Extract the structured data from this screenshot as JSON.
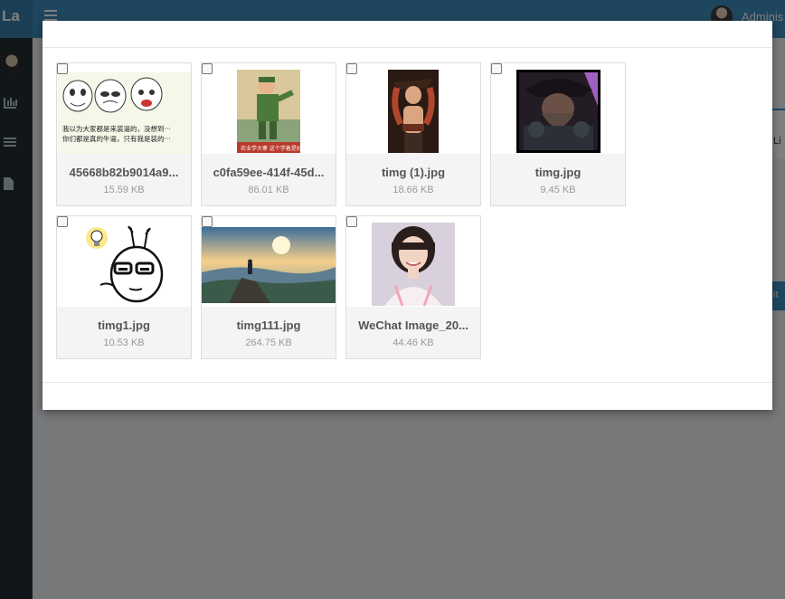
{
  "app": {
    "brand": "La",
    "user_name": "Adminis"
  },
  "background": {
    "panel_text": "Li",
    "button_label": "it"
  },
  "files": [
    {
      "name": "45668b82b9014a9...",
      "size": "15.59 KB",
      "thumb": "meme-faces"
    },
    {
      "name": "c0fa59ee-414f-45d...",
      "size": "86.01 KB",
      "thumb": "poster"
    },
    {
      "name": "timg (1).jpg",
      "size": "18.66 KB",
      "thumb": "pirate-woman"
    },
    {
      "name": "timg.jpg",
      "size": "9.45 KB",
      "thumb": "pirate-man"
    },
    {
      "name": "timg1.jpg",
      "size": "10.53 KB",
      "thumb": "bunny-lightbulb"
    },
    {
      "name": "timg111.jpg",
      "size": "264.75 KB",
      "thumb": "landscape"
    },
    {
      "name": "WeChat Image_20...",
      "size": "44.46 KB",
      "thumb": "portrait"
    }
  ],
  "meme_caption": [
    "我以为大家都是来装逼的，没想到···",
    "你们都是真的牛逼，只有我是装的···"
  ],
  "poster_caption": "农业学大寨 这个学着是好"
}
